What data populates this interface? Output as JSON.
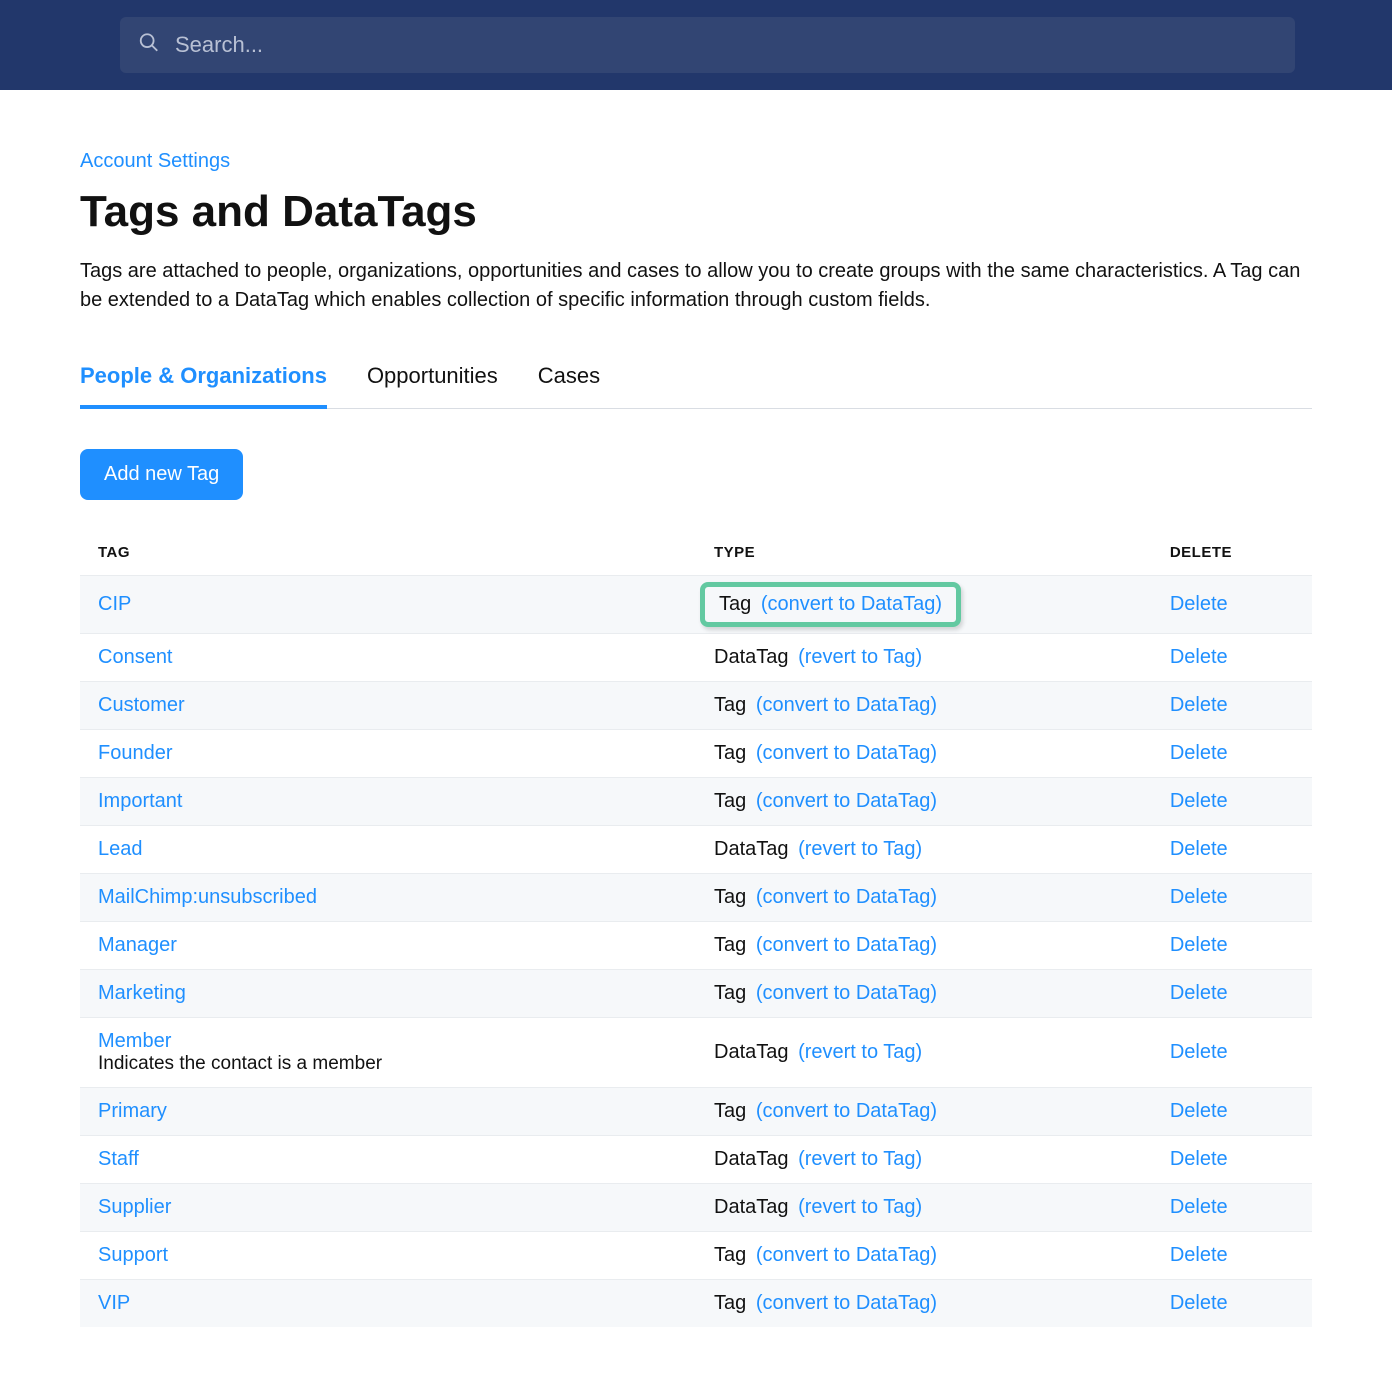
{
  "search": {
    "placeholder": "Search..."
  },
  "breadcrumb": "Account Settings",
  "title": "Tags and DataTags",
  "description": "Tags are attached to people, organizations, opportunities and cases to allow you to create groups with the same characteristics. A Tag can be extended to a DataTag which enables collection of specific information through custom fields.",
  "tabs": {
    "people": "People & Organizations",
    "opportunities": "Opportunities",
    "cases": "Cases"
  },
  "add_button": "Add new Tag",
  "columns": {
    "tag": "TAG",
    "type": "TYPE",
    "delete": "DELETE"
  },
  "delete_label": "Delete",
  "actions": {
    "convert": "(convert to DataTag)",
    "revert": "(revert to Tag)"
  },
  "type_labels": {
    "tag": "Tag",
    "datatag": "DataTag"
  },
  "rows": [
    {
      "name": "CIP",
      "type": "tag",
      "highlight": true
    },
    {
      "name": "Consent",
      "type": "datatag"
    },
    {
      "name": "Customer",
      "type": "tag"
    },
    {
      "name": "Founder",
      "type": "tag"
    },
    {
      "name": "Important",
      "type": "tag"
    },
    {
      "name": "Lead",
      "type": "datatag"
    },
    {
      "name": "MailChimp:unsubscribed",
      "type": "tag"
    },
    {
      "name": "Manager",
      "type": "tag"
    },
    {
      "name": "Marketing",
      "type": "tag"
    },
    {
      "name": "Member",
      "type": "datatag",
      "desc": "Indicates the contact is a member"
    },
    {
      "name": "Primary",
      "type": "tag"
    },
    {
      "name": "Staff",
      "type": "datatag"
    },
    {
      "name": "Supplier",
      "type": "datatag"
    },
    {
      "name": "Support",
      "type": "tag"
    },
    {
      "name": "VIP",
      "type": "tag"
    }
  ]
}
